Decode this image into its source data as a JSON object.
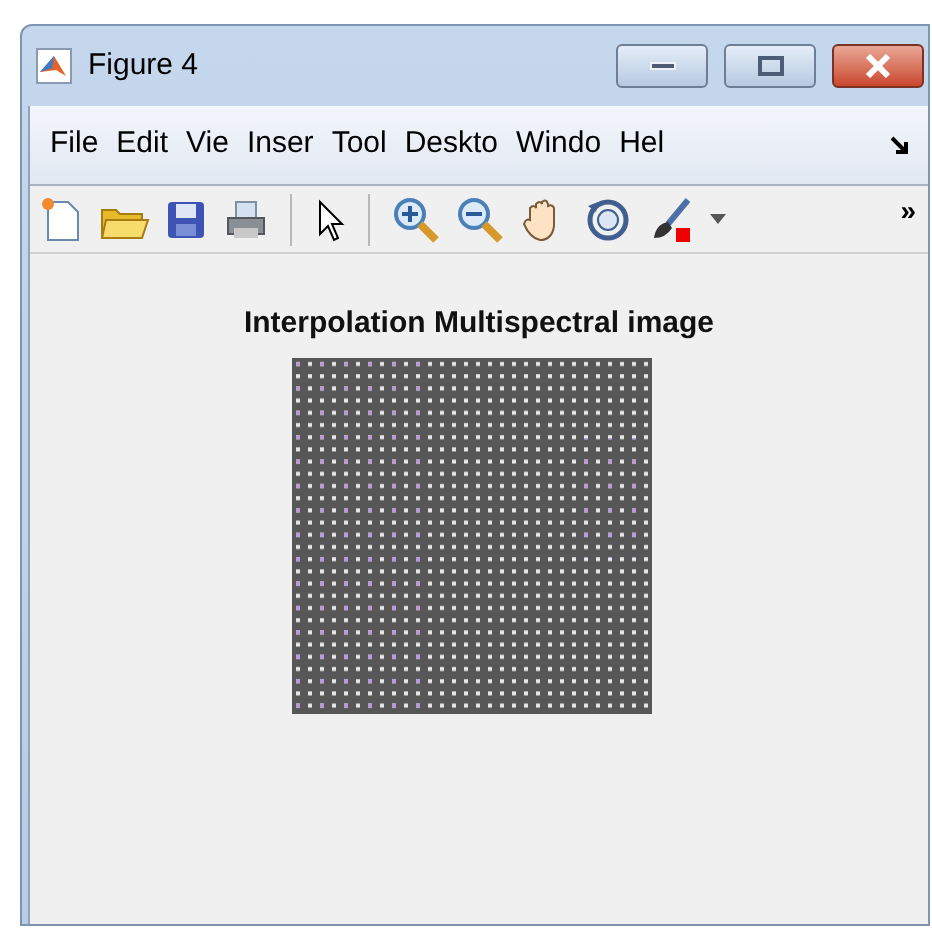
{
  "window": {
    "title": "Figure 4"
  },
  "menu": [
    "File",
    "Edit",
    "Vie",
    "Inser",
    "Tool",
    "Deskto",
    "Windo",
    "Hel"
  ],
  "toolbar": {
    "overflow": "»"
  },
  "axes": {
    "title": "Interpolation Multispectral image"
  }
}
